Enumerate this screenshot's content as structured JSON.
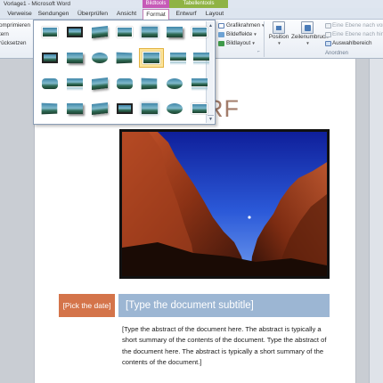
{
  "window": {
    "title": "Vorlage1 - Microsoft Word"
  },
  "context_groups": {
    "picture_tools": "Bildtools",
    "table_tools": "Tabellentools"
  },
  "tabs": [
    "Verweise",
    "Sendungen",
    "Überprüfen",
    "Ansicht",
    "Format",
    "Entwurf",
    "Layout"
  ],
  "active_tab": "Format",
  "ribbon": {
    "left_fragments": [
      "omprimieren",
      "tern",
      "rücksetzen"
    ],
    "picture_styles": {
      "border": "Grafikrahmen",
      "effects": "Bildeffekte",
      "layout": "Bildlayout"
    },
    "arrange": {
      "position": "Position",
      "wrap_line1": "Zeilenumbruch",
      "bring_forward": "Eine Ebene nach vorn",
      "send_backward": "Eine Ebene nach hinten",
      "selection_pane": "Auswahlbereich",
      "group_label": "Anordnen"
    }
  },
  "document": {
    "title_fragment": "RF",
    "date_placeholder": "[Pick the date]",
    "subtitle_placeholder": "[Type the document subtitle]",
    "abstract": "[Type the abstract of the document here. The abstract is typically a short summary of the contents of the document. Type the abstract of the document here. The abstract is typically a short summary of the contents of the document.]"
  },
  "colors": {
    "date_box": "#d4744a",
    "subtitle_box": "#9cb6d3",
    "title_text": "#a27c6a",
    "picture_tools_tab": "#c65ab7",
    "table_tools_tab": "#8fb344"
  },
  "icons": {
    "border": "picture-border-icon",
    "effects": "picture-effects-icon",
    "layout": "picture-layout-icon",
    "position": "position-icon",
    "wrap": "wrap-text-icon",
    "bring_forward": "bring-forward-icon",
    "send_backward": "send-backward-icon",
    "selection_pane": "selection-pane-icon"
  }
}
